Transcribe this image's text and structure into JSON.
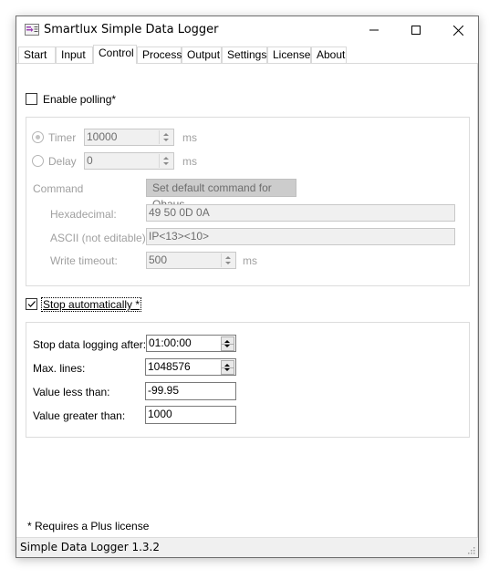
{
  "window": {
    "title": "Smartlux Simple Data Logger",
    "controls": {
      "minimize": "minimize-icon",
      "maximize": "maximize-icon",
      "close": "close-icon"
    }
  },
  "tabs": [
    {
      "label": "Start",
      "active": false
    },
    {
      "label": "Input",
      "active": false
    },
    {
      "label": "Control",
      "active": true
    },
    {
      "label": "Process",
      "active": false
    },
    {
      "label": "Output",
      "active": false
    },
    {
      "label": "Settings",
      "active": false
    },
    {
      "label": "License",
      "active": false
    },
    {
      "label": "About",
      "active": false
    }
  ],
  "polling": {
    "enable_label": "Enable polling*",
    "enabled": false,
    "timer": {
      "label": "Timer",
      "value": "10000",
      "unit": "ms",
      "selected": true
    },
    "delay": {
      "label": "Delay",
      "value": "0",
      "unit": "ms",
      "selected": false
    },
    "command_label": "Command",
    "default_command_button": "Set default command for Ohaus",
    "hexadecimal": {
      "label": "Hexadecimal:",
      "value": "49 50 0D 0A"
    },
    "ascii": {
      "label": "ASCII (not editable):",
      "value": "IP<13><10>"
    },
    "write_timeout": {
      "label": "Write timeout:",
      "value": "500",
      "unit": "ms"
    }
  },
  "stop": {
    "enable_label": "Stop automatically *",
    "enabled": true,
    "after": {
      "label": "Stop data logging after:",
      "value": "01:00:00"
    },
    "max_lines": {
      "label": "Max. lines:",
      "value": "1048576"
    },
    "less_than": {
      "label": "Value less than:",
      "value": "-99.95"
    },
    "greater_than": {
      "label": "Value greater than:",
      "value": "1000"
    }
  },
  "footnote": "* Requires a Plus license",
  "status": {
    "text": "Simple Data Logger 1.3.2"
  }
}
